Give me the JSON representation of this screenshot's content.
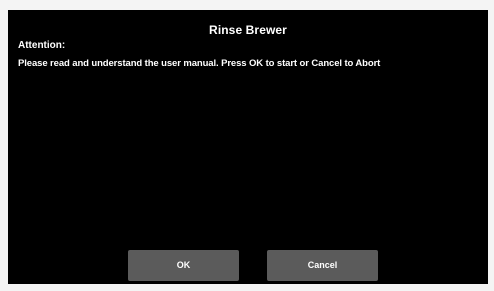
{
  "dialog": {
    "title": "Rinse Brewer",
    "attention_label": "Attention:",
    "message": "Please read and understand the user manual.  Press OK to start or Cancel to Abort",
    "ok_label": "OK",
    "cancel_label": "Cancel"
  },
  "colors": {
    "screen_background": "#000000",
    "text": "#ffffff",
    "button_background": "#5b5b5b"
  }
}
